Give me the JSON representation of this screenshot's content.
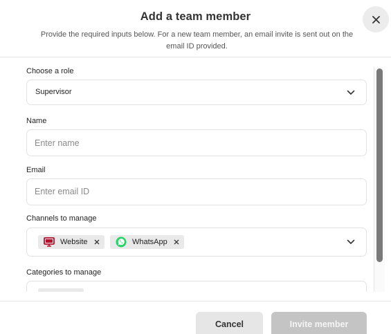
{
  "dialog": {
    "title": "Add a team member",
    "subtitle": "Provide the required inputs below. For a new team member, an email invite is sent out on the email ID provided.",
    "close_icon": "close-icon"
  },
  "form": {
    "role": {
      "label": "Choose a role",
      "value": "Supervisor"
    },
    "name": {
      "label": "Name",
      "placeholder": "Enter name"
    },
    "email": {
      "label": "Email",
      "placeholder": "Enter email ID"
    },
    "channels": {
      "label": "Channels to manage",
      "chips": [
        {
          "label": "Website",
          "icon": "monitor-icon",
          "color": "#b3112e"
        },
        {
          "label": "WhatsApp",
          "icon": "whatsapp-icon",
          "color": "#25d366"
        }
      ]
    },
    "categories": {
      "label": "Categories to manage"
    }
  },
  "footer": {
    "cancel_label": "Cancel",
    "invite_label": "Invite member"
  },
  "colors": {
    "disabled_button": "#c4c4c4",
    "secondary_button": "#e6e6e6"
  }
}
